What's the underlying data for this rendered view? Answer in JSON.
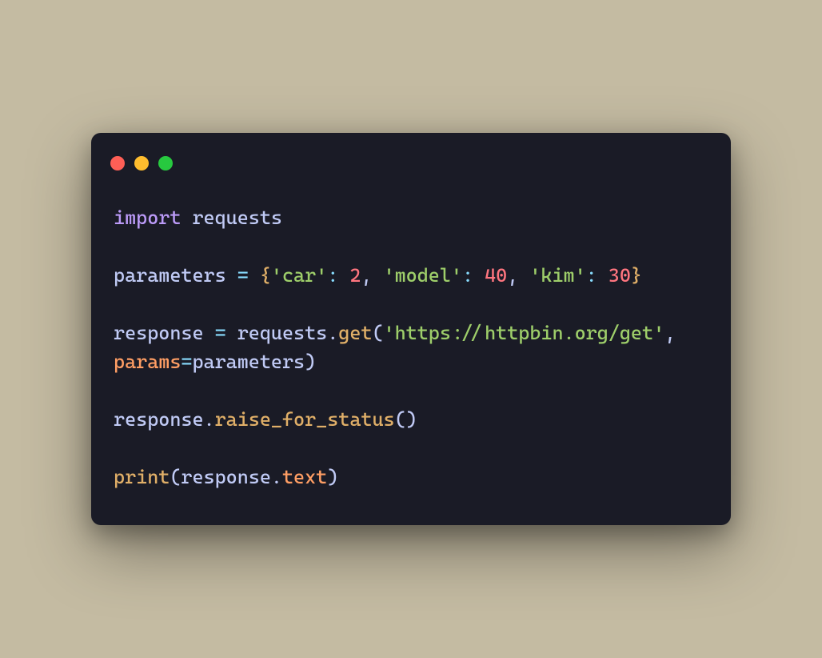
{
  "code": {
    "line1": {
      "kw": "import",
      "sp": " ",
      "mod": "requests"
    },
    "line2": "",
    "line3": {
      "var": "parameters",
      "sp1": " ",
      "eq": "=",
      "sp2": " ",
      "lbrace": "{",
      "k1": "'car'",
      "colon1": ":",
      "sp3": " ",
      "v1": "2",
      "comma1": ",",
      "sp4": " ",
      "k2": "'model'",
      "colon2": ":",
      "sp5": " ",
      "v2": "40",
      "comma2": ",",
      "sp6": " ",
      "k3": "'kim'",
      "colon3": ":",
      "sp7": " ",
      "v3": "30",
      "rbrace": "}"
    },
    "line4": "",
    "line5": {
      "var": "response",
      "sp1": " ",
      "eq": "=",
      "sp2": " ",
      "obj": "requests",
      "dot": ".",
      "method": "get",
      "lp": "(",
      "url": "'https://httpbin.org/get'",
      "comma": ",",
      "sp3": " ",
      "kw": "params",
      "eq2": "=",
      "val": "parameters",
      "rp": ")"
    },
    "line6": "",
    "line7": {
      "obj": "response",
      "dot": ".",
      "method": "raise_for_status",
      "lp": "(",
      "rp": ")"
    },
    "line8": "",
    "line9": {
      "fn": "print",
      "lp": "(",
      "obj": "response",
      "dot": ".",
      "attr": "text",
      "rp": ")"
    }
  }
}
